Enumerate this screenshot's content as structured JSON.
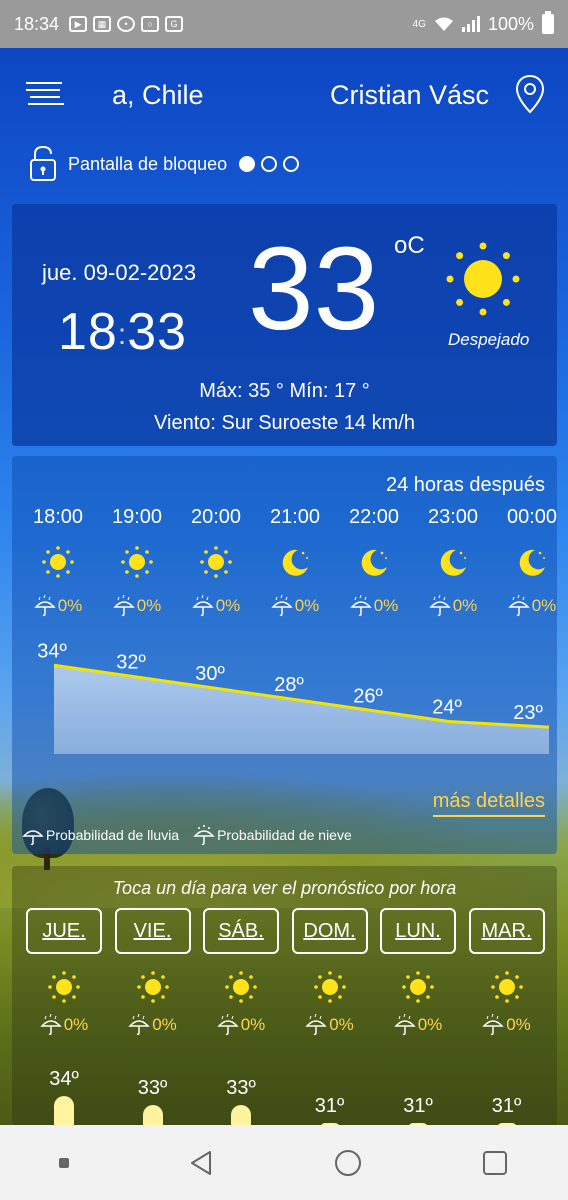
{
  "status_bar": {
    "time": "18:34",
    "battery": "100%",
    "notification_icons": [
      "youtube-icon",
      "app-icon",
      "message-icon",
      "instagram-icon",
      "news-icon"
    ],
    "network": "4G"
  },
  "header": {
    "location_left": "a, Chile",
    "location_right": "Cristian Vásc"
  },
  "lock_screen": {
    "label": "Pantalla de bloqueo",
    "pages": 3,
    "active_page": 1
  },
  "current": {
    "date": "jue. 09-02-2023",
    "clock_h": "18",
    "clock_m": "33",
    "temperature": "33",
    "unit": "oC",
    "condition": "Despejado",
    "max_min": "Máx: 35 °  Mín: 17 °",
    "wind": "Viento: Sur Suroeste 14 km/h"
  },
  "hourly": {
    "title": "24 horas después",
    "items": [
      {
        "time": "18:00",
        "icon": "sun-icon",
        "rain": "0%",
        "temp": "34º"
      },
      {
        "time": "19:00",
        "icon": "sun-icon",
        "rain": "0%",
        "temp": "32º"
      },
      {
        "time": "20:00",
        "icon": "sun-icon",
        "rain": "0%",
        "temp": "30º"
      },
      {
        "time": "21:00",
        "icon": "moon-icon",
        "rain": "0%",
        "temp": "28º"
      },
      {
        "time": "22:00",
        "icon": "moon-icon",
        "rain": "0%",
        "temp": "26º"
      },
      {
        "time": "23:00",
        "icon": "moon-icon",
        "rain": "0%",
        "temp": "24º"
      },
      {
        "time": "00:00",
        "icon": "moon-icon",
        "rain": "0%",
        "temp": "23º"
      }
    ],
    "more_details": "más detalles",
    "legend_rain": "Probabilidad de lluvia",
    "legend_snow": "Probabilidad de nieve"
  },
  "daily": {
    "title": "Toca un día para ver el pronóstico por hora",
    "items": [
      {
        "day": "JUE.",
        "icon": "sun-icon",
        "rain": "0%",
        "max": "34º"
      },
      {
        "day": "VIE.",
        "icon": "sun-icon",
        "rain": "0%",
        "max": "33º"
      },
      {
        "day": "SÁB.",
        "icon": "sun-icon",
        "rain": "0%",
        "max": "33º"
      },
      {
        "day": "DOM.",
        "icon": "sun-icon",
        "rain": "0%",
        "max": "31º"
      },
      {
        "day": "LUN.",
        "icon": "sun-icon",
        "rain": "0%",
        "max": "31º"
      },
      {
        "day": "MAR.",
        "icon": "sun-icon",
        "rain": "0%",
        "max": "31º"
      },
      {
        "day": "",
        "icon": "",
        "rain": "",
        "max": ""
      }
    ]
  },
  "colors": {
    "accent": "#ffd34a",
    "sun": "#ffe21a",
    "line": "#f2e300"
  }
}
